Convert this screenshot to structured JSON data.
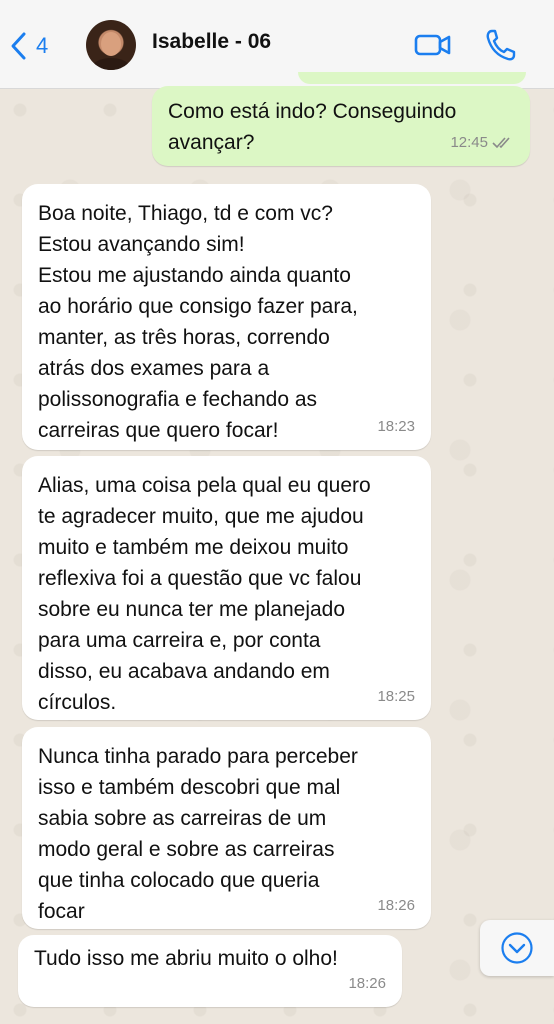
{
  "header": {
    "back_count": "4",
    "contact_name": "Isabelle - 06"
  },
  "messages": [
    {
      "direction": "outgoing",
      "text": "Como está indo? Conseguindo\navançar?",
      "time": "12:45",
      "read": true
    },
    {
      "direction": "incoming",
      "text": "Boa noite, Thiago, td e com vc?\nEstou avançando sim!\nEstou me ajustando ainda quanto\nao horário que consigo fazer para,\nmanter, as três horas, correndo\natrás dos exames para a\npolissonografia e fechando as\ncarreiras que quero focar!",
      "time": "18:23"
    },
    {
      "direction": "incoming",
      "text": "Alias, uma coisa pela qual eu quero\nte agradecer muito, que me ajudou\nmuito e também me deixou muito\nreflexiva foi a questão que vc falou\nsobre eu nunca ter me planejado\npara uma carreira e, por conta\ndisso, eu acabava andando em\ncírculos.",
      "time": "18:25"
    },
    {
      "direction": "incoming",
      "text": "Nunca tinha parado para perceber\nisso e também descobri que mal\nsabia sobre as carreiras de um\nmodo geral e sobre as carreiras\nque tinha colocado que queria\nfocar",
      "time": "18:26"
    },
    {
      "direction": "incoming",
      "text": "Tudo isso me abriu muito o olho!",
      "time": "18:26"
    }
  ],
  "icons": {
    "back": "chevron-left-icon",
    "video": "video-camera-icon",
    "call": "phone-icon",
    "read_receipt": "double-check-icon",
    "scroll_down": "chevron-down-circle-icon"
  },
  "colors": {
    "accent": "#1B7EEF",
    "outgoing_bubble": "#DCF7C5",
    "incoming_bubble": "#FFFFFF",
    "wallpaper": "#ECE6DD"
  }
}
